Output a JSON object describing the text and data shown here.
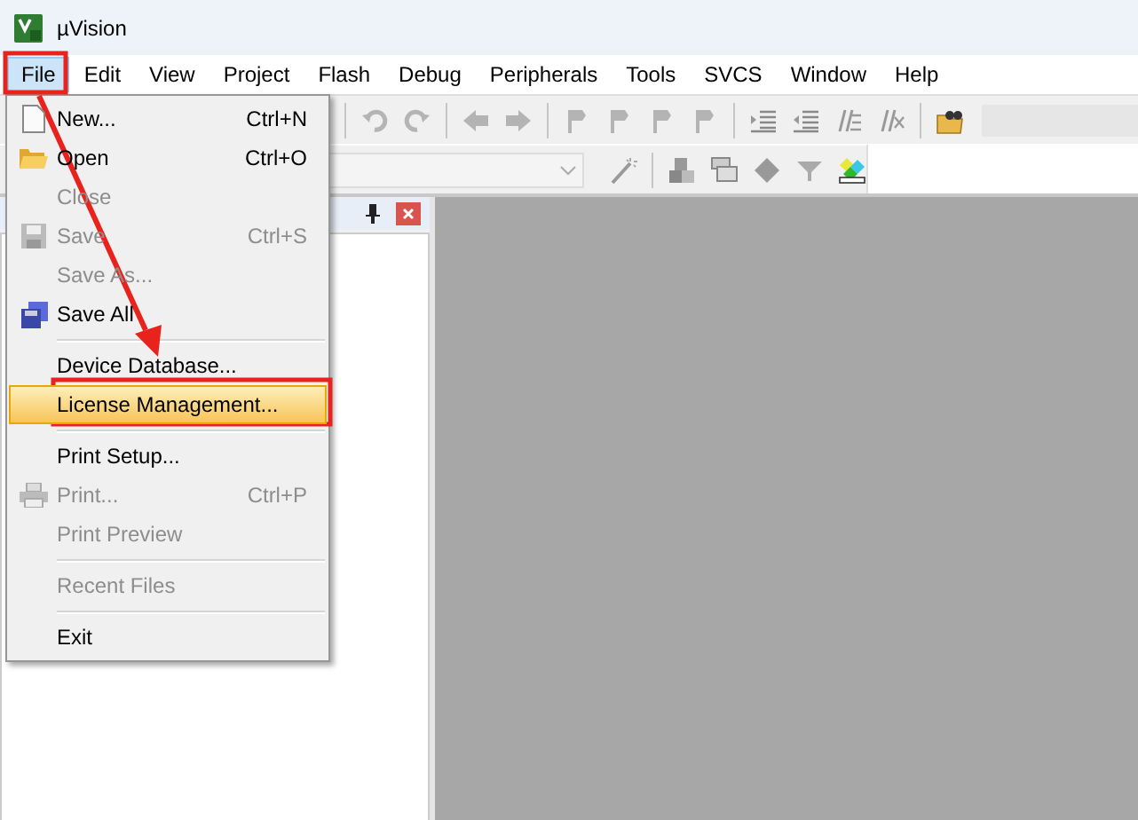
{
  "window": {
    "title": "µVision"
  },
  "menu_bar": [
    {
      "label": "File",
      "selected": true
    },
    {
      "label": "Edit",
      "selected": false
    },
    {
      "label": "View",
      "selected": false
    },
    {
      "label": "Project",
      "selected": false
    },
    {
      "label": "Flash",
      "selected": false
    },
    {
      "label": "Debug",
      "selected": false
    },
    {
      "label": "Peripherals",
      "selected": false
    },
    {
      "label": "Tools",
      "selected": false
    },
    {
      "label": "SVCS",
      "selected": false
    },
    {
      "label": "Window",
      "selected": false
    },
    {
      "label": "Help",
      "selected": false
    }
  ],
  "file_menu": {
    "items": [
      {
        "kind": "item",
        "label": "New...",
        "shortcut": "Ctrl+N",
        "disabled": false,
        "selected": false
      },
      {
        "kind": "item",
        "label": "Open",
        "shortcut": "Ctrl+O",
        "disabled": false,
        "selected": false
      },
      {
        "kind": "item",
        "label": "Close",
        "disabled": true,
        "selected": false
      },
      {
        "kind": "item",
        "label": "Save",
        "shortcut": "Ctrl+S",
        "disabled": true,
        "selected": false
      },
      {
        "kind": "item",
        "label": "Save As...",
        "disabled": true,
        "selected": false
      },
      {
        "kind": "item",
        "label": "Save All",
        "disabled": false,
        "selected": false
      },
      {
        "kind": "separator"
      },
      {
        "kind": "item",
        "label": "Device Database...",
        "disabled": false,
        "selected": false
      },
      {
        "kind": "item",
        "label": "License Management...",
        "disabled": false,
        "selected": true
      },
      {
        "kind": "separator"
      },
      {
        "kind": "item",
        "label": "Print Setup...",
        "disabled": false,
        "selected": false
      },
      {
        "kind": "item",
        "label": "Print...",
        "shortcut": "Ctrl+P",
        "disabled": true,
        "selected": false
      },
      {
        "kind": "item",
        "label": "Print Preview",
        "disabled": true,
        "selected": false
      },
      {
        "kind": "separator"
      },
      {
        "kind": "item",
        "label": "Recent Files",
        "disabled": true,
        "selected": false
      },
      {
        "kind": "separator"
      },
      {
        "kind": "item",
        "label": "Exit",
        "disabled": false,
        "selected": false
      }
    ]
  }
}
